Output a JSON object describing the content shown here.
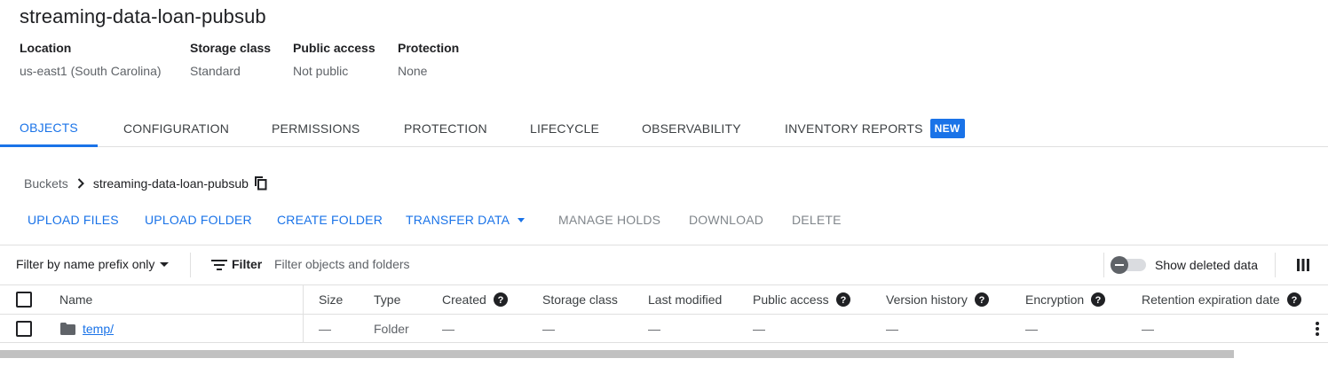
{
  "bucket": {
    "name": "streaming-data-loan-pubsub"
  },
  "meta": [
    {
      "label": "Location",
      "value": "us-east1 (South Carolina)"
    },
    {
      "label": "Storage class",
      "value": "Standard"
    },
    {
      "label": "Public access",
      "value": "Not public"
    },
    {
      "label": "Protection",
      "value": "None"
    }
  ],
  "tabs": [
    {
      "label": "OBJECTS",
      "active": true
    },
    {
      "label": "CONFIGURATION"
    },
    {
      "label": "PERMISSIONS"
    },
    {
      "label": "PROTECTION"
    },
    {
      "label": "LIFECYCLE"
    },
    {
      "label": "OBSERVABILITY"
    },
    {
      "label": "INVENTORY REPORTS",
      "badge": "NEW"
    }
  ],
  "breadcrumb": {
    "root": "Buckets",
    "current": "streaming-data-loan-pubsub"
  },
  "toolbar": {
    "upload_files": "UPLOAD FILES",
    "upload_folder": "UPLOAD FOLDER",
    "create_folder": "CREATE FOLDER",
    "transfer_data": "TRANSFER DATA",
    "manage_holds": "MANAGE HOLDS",
    "download": "DOWNLOAD",
    "delete": "DELETE"
  },
  "filter": {
    "prefix_select": "Filter by name prefix only",
    "label": "Filter",
    "placeholder": "Filter objects and folders",
    "show_deleted": "Show deleted data"
  },
  "table": {
    "headers": {
      "name": "Name",
      "size": "Size",
      "type": "Type",
      "created": "Created",
      "storage_class": "Storage class",
      "last_modified": "Last modified",
      "public_access": "Public access",
      "version_history": "Version history",
      "encryption": "Encryption",
      "retention": "Retention expiration date"
    },
    "rows": [
      {
        "name": "temp/",
        "size": "—",
        "type": "Folder",
        "created": "—",
        "storage_class": "—",
        "last_modified": "—",
        "public_access": "—",
        "version_history": "—",
        "encryption": "—",
        "retention": "—"
      }
    ]
  },
  "icons": {
    "copy": "copy-icon",
    "filter": "filter-list-icon",
    "columns": "view-column-icon",
    "help": "help-circle-icon",
    "folder": "folder-icon",
    "more": "more-vert-icon",
    "chevron": "chevron-right-icon"
  },
  "colors": {
    "accent": "#1a73e8",
    "text": "#202124",
    "muted": "#5f6368"
  }
}
